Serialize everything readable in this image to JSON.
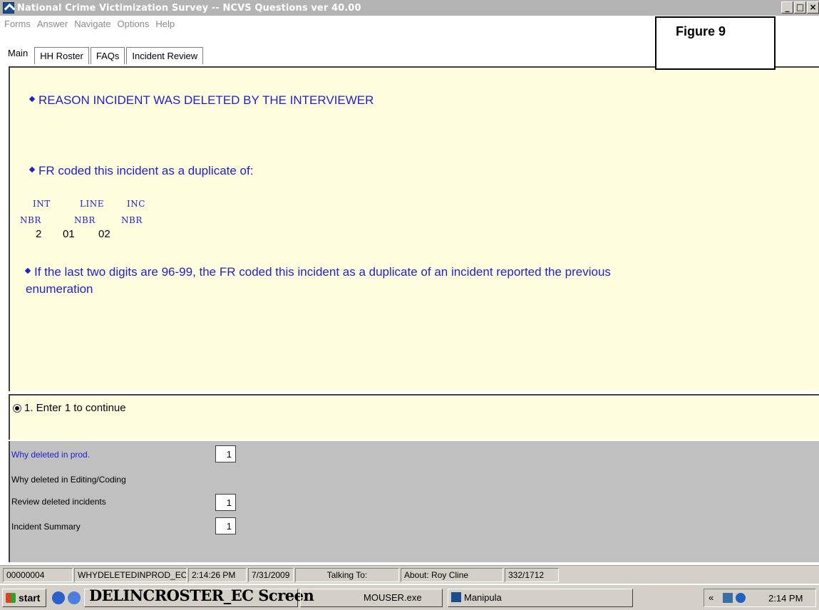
{
  "window": {
    "title": "National Crime Victimization Survey -- NCVS Questions ver 40.00",
    "controls": [
      "_",
      "B",
      "X"
    ]
  },
  "menu": {
    "items": [
      "Forms",
      "Answer",
      "Navigate",
      "Options",
      "Help"
    ]
  },
  "figure_label": "Figure 9",
  "tabs": [
    "Main",
    "HH Roster",
    "FAQs",
    "Incident Review"
  ],
  "question": {
    "heading": "REASON INCIDENT WAS DELETED BY THE INTERVIEWER",
    "line2": "FR coded this incident as a duplicate of:",
    "table_headers_top": [
      "INT",
      "LINE",
      "INC"
    ],
    "table_headers_bottom": [
      "NBR",
      "NBR",
      "NBR"
    ],
    "table_values": [
      "2",
      "01",
      "02"
    ],
    "line3": "If the last two digits are 96-99, the FR coded this incident as a duplicate of an incident reported the previous",
    "line3b": "enumeration"
  },
  "answer": {
    "option": "1. Enter 1 to continue"
  },
  "fields": [
    {
      "label": "Why deleted in prod.",
      "value": "1",
      "highlight": true
    },
    {
      "label": "Why deleted in Editing/Coding",
      "value": ""
    },
    {
      "label": "Review deleted incidents",
      "value": "1"
    },
    {
      "label": "Incident Summary",
      "value": "1"
    }
  ],
  "status": {
    "record": "00000004",
    "field": "WHYDELETEDINPROD_EC",
    "time": "2:14:26 PM",
    "date": "7/31/2009",
    "talking": "Talking To:",
    "about": "About:  Roy Cline",
    "count": "332/1712"
  },
  "taskbar": {
    "start": "start",
    "overlay_text": "DELINCROSTER_EC Screen",
    "task1": "MOUSER.exe",
    "task2": "Manipula",
    "tray_arrows": "«",
    "clock": "2:14 PM"
  },
  "colors": {
    "question_blue": "#2020d0",
    "panel_yellow": "#ffffe0",
    "grid_gray": "#c0c0c0"
  }
}
